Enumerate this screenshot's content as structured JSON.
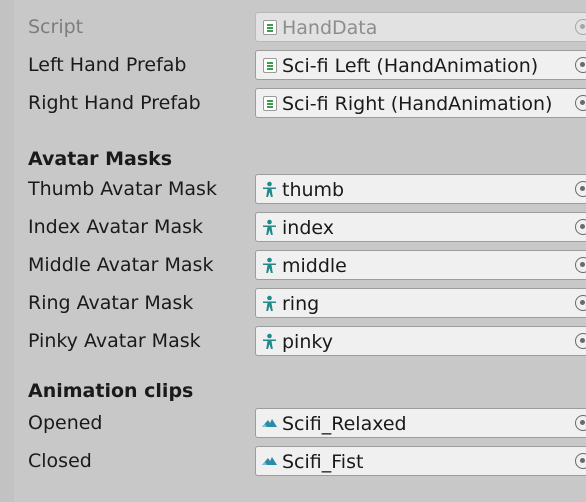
{
  "script": {
    "label": "Script",
    "value": "HandData",
    "icon": "script-icon"
  },
  "prefabs": [
    {
      "label": "Left Hand Prefab",
      "value": "Sci-fi Left (HandAnimation)",
      "icon": "script-icon"
    },
    {
      "label": "Right Hand Prefab",
      "value": "Sci-fi Right (HandAnimation)",
      "icon": "script-icon"
    }
  ],
  "avatar_masks": {
    "header": "Avatar Masks",
    "items": [
      {
        "label": "Thumb Avatar Mask",
        "value": "thumb",
        "icon": "avatar-mask-icon"
      },
      {
        "label": "Index Avatar Mask",
        "value": "index",
        "icon": "avatar-mask-icon"
      },
      {
        "label": "Middle Avatar Mask",
        "value": "middle",
        "icon": "avatar-mask-icon"
      },
      {
        "label": "Ring Avatar Mask",
        "value": "ring",
        "icon": "avatar-mask-icon"
      },
      {
        "label": "Pinky Avatar Mask",
        "value": "pinky",
        "icon": "avatar-mask-icon"
      }
    ]
  },
  "animation_clips": {
    "header": "Animation clips",
    "items": [
      {
        "label": "Opened",
        "value": "Scifi_Relaxed",
        "icon": "animation-clip-icon"
      },
      {
        "label": "Closed",
        "value": "Scifi_Fist",
        "icon": "animation-clip-icon"
      }
    ]
  },
  "colors": {
    "panel_bg": "#c8c8c8",
    "field_bg": "#f0f0f0",
    "avatar_icon": "#1e8a8a",
    "clip_icon": "#2a8aa8",
    "script_icon": "#3a9d4a"
  }
}
